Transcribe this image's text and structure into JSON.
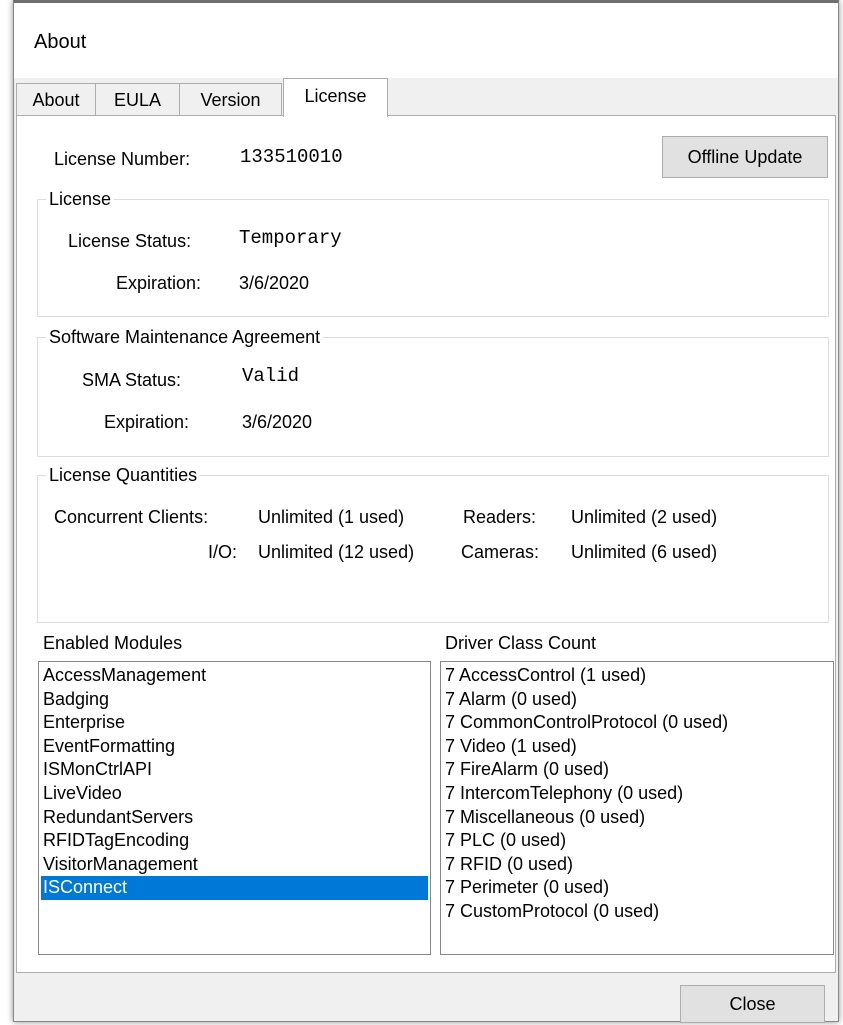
{
  "window": {
    "title": "About"
  },
  "tabs": [
    {
      "label": "About"
    },
    {
      "label": "EULA"
    },
    {
      "label": "Version"
    },
    {
      "label": "License"
    }
  ],
  "license_number": {
    "label": "License Number:",
    "value": "133510010"
  },
  "offline_update_button": "Offline Update",
  "license_group": {
    "legend": "License",
    "status_label": "License Status:",
    "status_value": "Temporary",
    "expiration_label": "Expiration:",
    "expiration_value": "3/6/2020"
  },
  "sma_group": {
    "legend": "Software Maintenance Agreement",
    "status_label": "SMA Status:",
    "status_value": "Valid",
    "expiration_label": "Expiration:",
    "expiration_value": "3/6/2020"
  },
  "quantities_group": {
    "legend": "License Quantities",
    "concurrent_clients_label": "Concurrent Clients:",
    "concurrent_clients_value": "Unlimited (1 used)",
    "readers_label": "Readers:",
    "readers_value": "Unlimited (2 used)",
    "io_label": "I/O:",
    "io_value": "Unlimited (12 used)",
    "cameras_label": "Cameras:",
    "cameras_value": "Unlimited (6 used)"
  },
  "enabled_modules": {
    "label": "Enabled Modules",
    "items": [
      "AccessManagement",
      "Badging",
      "Enterprise",
      "EventFormatting",
      "ISMonCtrlAPI",
      "LiveVideo",
      "RedundantServers",
      "RFIDTagEncoding",
      "VisitorManagement",
      "ISConnect"
    ],
    "selected_item": "ISConnect"
  },
  "driver_class_count": {
    "label": "Driver Class Count",
    "items": [
      "7 AccessControl (1 used)",
      "7 Alarm (0 used)",
      "7 CommonControlProtocol (0 used)",
      "7 Video (1 used)",
      "7 FireAlarm (0 used)",
      "7 IntercomTelephony (0 used)",
      "7 Miscellaneous (0 used)",
      "7 PLC (0 used)",
      "7 RFID (0 used)",
      "7 Perimeter (0 used)",
      "7 CustomProtocol (0 used)"
    ]
  },
  "close_button": "Close",
  "colors": {
    "selection": "#0078d7",
    "window_bg": "#f0f0f0",
    "button_bg": "#e1e1e1"
  }
}
